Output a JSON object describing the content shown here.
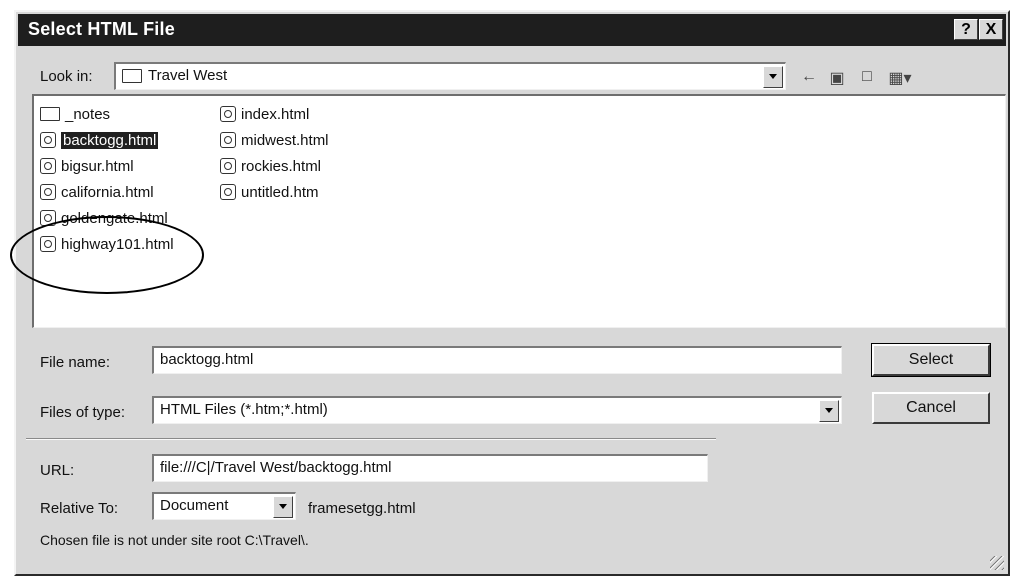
{
  "dialog": {
    "title": "Select HTML File",
    "help_button": "?",
    "close_button": "X"
  },
  "look_in": {
    "label": "Look in:",
    "value": "Travel West"
  },
  "toolbar": {
    "icons": [
      "back-arrow-icon",
      "up-folder-icon",
      "new-folder-icon",
      "view-menu-icon"
    ]
  },
  "files": {
    "col1": [
      {
        "name": "_notes",
        "type": "folder"
      },
      {
        "name": "backtogg.html",
        "type": "html",
        "selected": true
      },
      {
        "name": "bigsur.html",
        "type": "html"
      },
      {
        "name": "california.html",
        "type": "html"
      },
      {
        "name": "goldengate.html",
        "type": "html"
      },
      {
        "name": "highway101.html",
        "type": "html"
      }
    ],
    "col2": [
      {
        "name": "index.html",
        "type": "html"
      },
      {
        "name": "midwest.html",
        "type": "html"
      },
      {
        "name": "rockies.html",
        "type": "html"
      },
      {
        "name": "untitled.htm",
        "type": "html"
      }
    ]
  },
  "file_name": {
    "label": "File name:",
    "value": "backtogg.html"
  },
  "file_type": {
    "label": "Files of type:",
    "value": "HTML Files (*.htm;*.html)"
  },
  "buttons": {
    "select": "Select",
    "cancel": "Cancel"
  },
  "url": {
    "label": "URL:",
    "value": "file:///C|/Travel West/backtogg.html"
  },
  "relative_to": {
    "label": "Relative To:",
    "value": "Document",
    "file": "framesetgg.html"
  },
  "status": "Chosen file is not under site root C:\\Travel\\."
}
